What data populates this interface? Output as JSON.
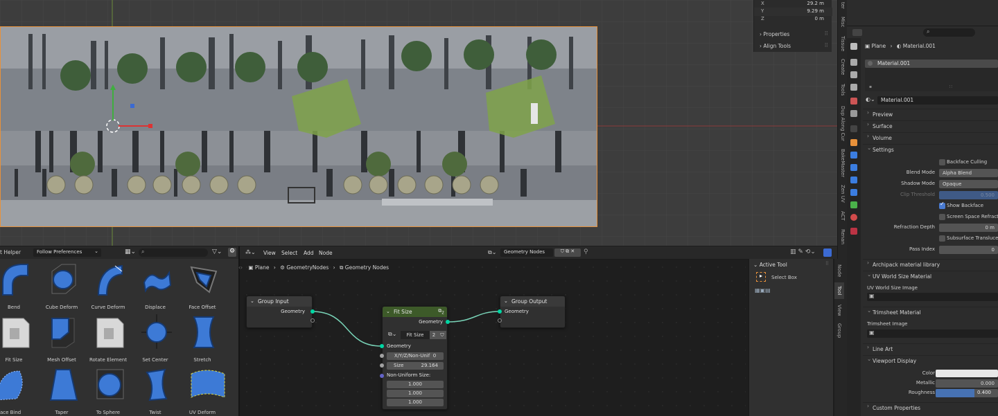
{
  "viewport": {
    "transform": [
      {
        "axis": "X",
        "value": "29.2 m"
      },
      {
        "axis": "Y",
        "value": "9.29 m"
      },
      {
        "axis": "Z",
        "value": "0 m"
      }
    ],
    "sections": [
      "Properties",
      "Align Tools"
    ],
    "tabs": [
      "ter",
      "Misc",
      "Tissue",
      "Create",
      "Tools",
      "Dup Along Cur",
      "BakeMaster",
      "Zen UV",
      "ACT",
      "Renan"
    ]
  },
  "properties": {
    "breadcrumb": {
      "object": "Plane",
      "material": "Material.001"
    },
    "slot": "Material.001",
    "material_name": "Material.001",
    "sections": {
      "preview": "Preview",
      "surface": "Surface",
      "volume": "Volume",
      "settings": "Settings",
      "archipack": "Archipack material library",
      "uvworld": "UV World Size Material",
      "uvworld_image": "UV World Size Image",
      "trimsheet": "Trimsheet Material",
      "trimsheet_image": "Trimsheet Image",
      "lineart": "Line Art",
      "viewport_display": "Viewport Display",
      "custom": "Custom Properties"
    },
    "settings": {
      "backface_culling": {
        "label": "Backface Culling",
        "checked": false
      },
      "blend_mode": {
        "label": "Blend Mode",
        "value": "Alpha Blend"
      },
      "shadow_mode": {
        "label": "Shadow Mode",
        "value": "Opaque"
      },
      "clip_threshold": {
        "label": "Clip Threshold",
        "value": "0.500"
      },
      "show_backface": {
        "label": "Show Backface",
        "checked": true
      },
      "ss_refraction": {
        "label": "Screen Space Refract",
        "checked": false
      },
      "refraction_depth": {
        "label": "Refraction Depth",
        "value": "0 m"
      },
      "subsurface": {
        "label": "Subsurface Transluce",
        "checked": false
      },
      "pass_index": {
        "label": "Pass Index",
        "value": "0"
      }
    },
    "viewport_display": {
      "color_label": "Color",
      "color": "#e8e8e8",
      "metallic_label": "Metallic",
      "metallic": "0.000",
      "roughness_label": "Roughness",
      "roughness": "0.400"
    }
  },
  "modifier_helper": {
    "title": "t Helper",
    "preferences": "Follow Preferences",
    "items": [
      "Bend",
      "Cube Deform",
      "Curve Deform",
      "Displace",
      "Face Offset",
      "Fit Size",
      "Mesh Offset",
      "Rotate Element",
      "Set Center",
      "Stretch",
      "Surface Bind",
      "Taper",
      "To Sphere",
      "Twist",
      "UV Deform"
    ]
  },
  "node_editor": {
    "menu": [
      "View",
      "Select",
      "Add",
      "Node"
    ],
    "node_tree": "Geometry Nodes",
    "breadcrumb": [
      "Plane",
      "GeometryNodes",
      "Geometry Nodes"
    ],
    "nodes": {
      "group_input": {
        "title": "Group Input",
        "output": "Geometry"
      },
      "fit_size": {
        "title": "Fit Size",
        "badge": "2",
        "output": "Geometry",
        "group_name": "Fit Size",
        "users": "2",
        "input": "Geometry",
        "mode": "X/Y/Z/Non-Unif",
        "mode_value": "0",
        "size_label": "Size",
        "size": "29.164",
        "nonuniform_label": "Non-Uniform Size:",
        "nonuniform": [
          "1.000",
          "1.000",
          "1.000"
        ]
      },
      "group_output": {
        "title": "Group Output",
        "input": "Geometry"
      }
    },
    "active_tool": {
      "title": "Active Tool",
      "tool": "Select Box"
    },
    "tabs": [
      "Node",
      "Tool",
      "View",
      "Group"
    ]
  }
}
